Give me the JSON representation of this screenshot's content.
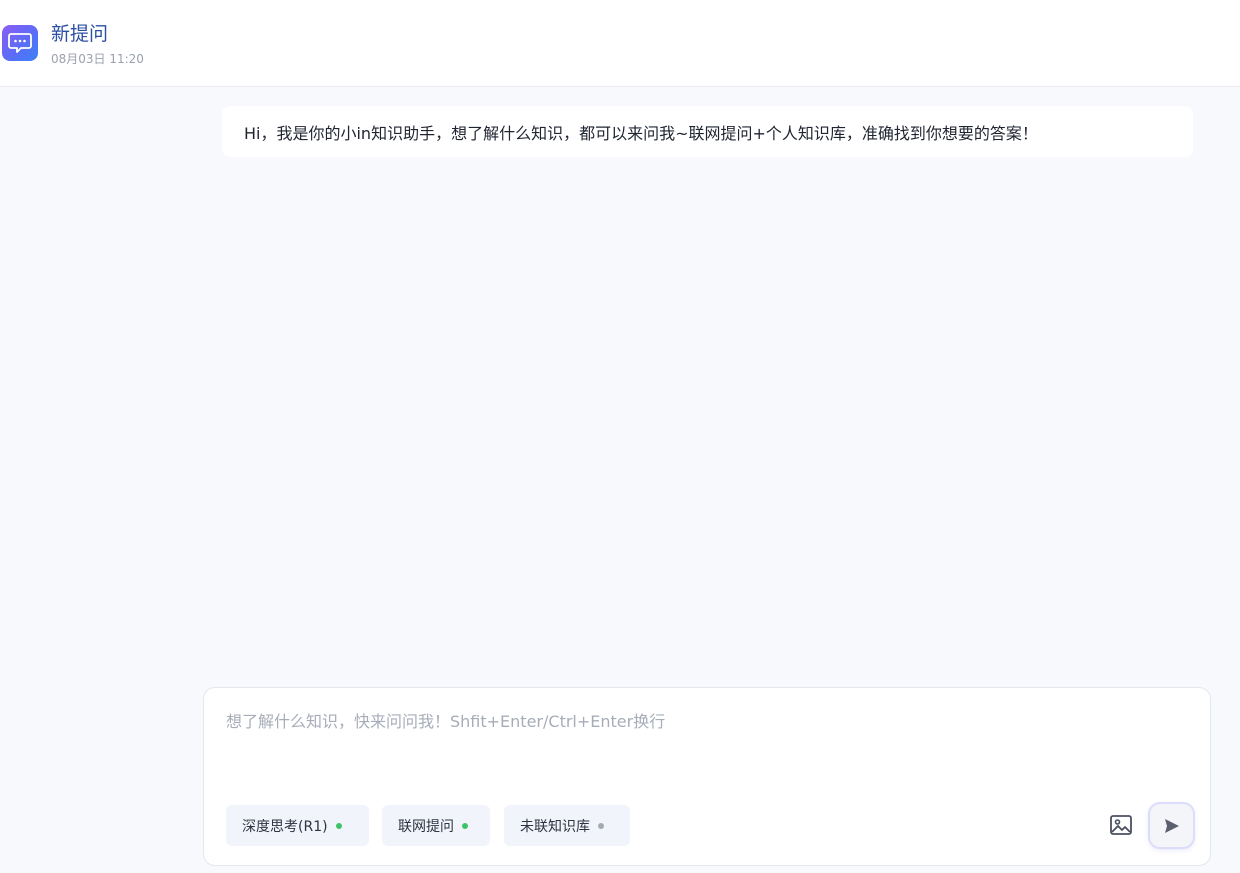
{
  "header": {
    "title": "新提问",
    "timestamp": "08月03日 11:20",
    "icon": "chat-bubble-icon"
  },
  "chat": {
    "messages": [
      {
        "role": "assistant",
        "text": "Hi，我是你的小in知识助手，想了解什么知识，都可以来问我~联网提问+个人知识库，准确找到你想要的答案！"
      }
    ]
  },
  "composer": {
    "placeholder": "想了解什么知识，快来问问我！Shfit+Enter/Ctrl+Enter换行",
    "value": "",
    "chips": [
      {
        "label": "深度思考(R1)",
        "status": "on",
        "dot_color": "#3fc36a"
      },
      {
        "label": "联网提问",
        "status": "on",
        "dot_color": "#3fc36a"
      },
      {
        "label": "未联知识库",
        "status": "off",
        "dot_color": "#a4a9b3"
      }
    ],
    "image_button_icon": "image-icon",
    "send_button_icon": "send-icon"
  },
  "colors": {
    "accent_title": "#2b4fa3",
    "background": "#f7f9fc",
    "status_on": "#3fc36a",
    "status_off": "#a4a9b3"
  }
}
